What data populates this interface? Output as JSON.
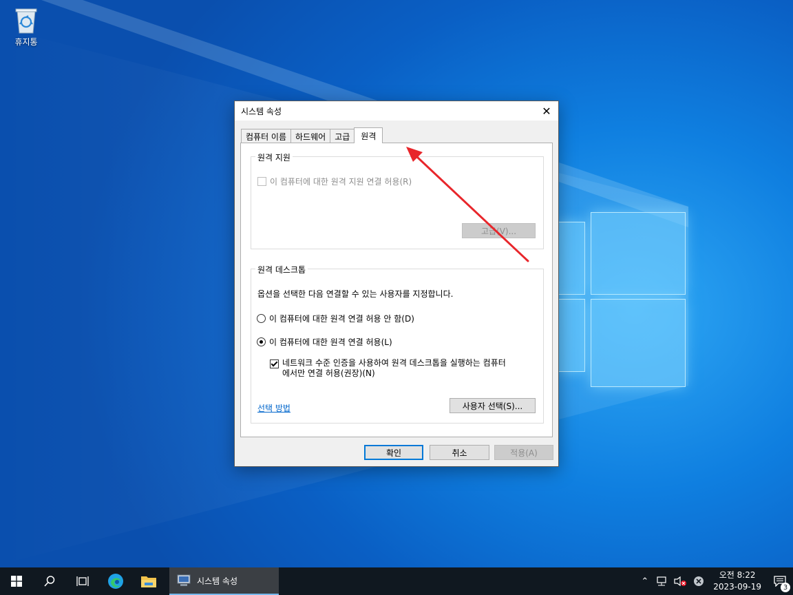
{
  "desktop": {
    "recycle_bin_label": "휴지통"
  },
  "dialog": {
    "title": "시스템 속성",
    "tabs": [
      {
        "label": "컴퓨터 이름"
      },
      {
        "label": "하드웨어"
      },
      {
        "label": "고급"
      },
      {
        "label": "원격"
      }
    ],
    "active_tab": "원격",
    "remote_assistance": {
      "legend": "원격 지원",
      "allow_checkbox_label": "이 컴퓨터에 대한 원격 지원 연결 허용(R)",
      "allow_checked": false,
      "advanced_button": "고급(V)..."
    },
    "remote_desktop": {
      "legend": "원격 데스크톱",
      "description": "옵션을 선택한 다음 연결할 수 있는 사용자를 지정합니다.",
      "option_deny": "이 컴퓨터에 대한 원격 연결 허용 안 함(D)",
      "option_allow": "이 컴퓨터에 대한 원격 연결 허용(L)",
      "selected_option": "allow",
      "nla_line1": "네트워크 수준 인증을 사용하여 원격 데스크톱을 실행하는 컴퓨터",
      "nla_line2": "에서만 연결 허용(권장)(N)",
      "nla_checked": true,
      "help_link": "선택 방법",
      "select_users_button": "사용자 선택(S)..."
    },
    "buttons": {
      "ok": "확인",
      "cancel": "취소",
      "apply": "적용(A)"
    }
  },
  "taskbar": {
    "active_app_label": "시스템 속성",
    "clock_time": "오전 8:22",
    "clock_date": "2023-09-19",
    "notification_count": "3"
  },
  "colors": {
    "annotation_arrow": "#e8262b",
    "accent": "#0078d7",
    "taskbar": "#101820"
  }
}
